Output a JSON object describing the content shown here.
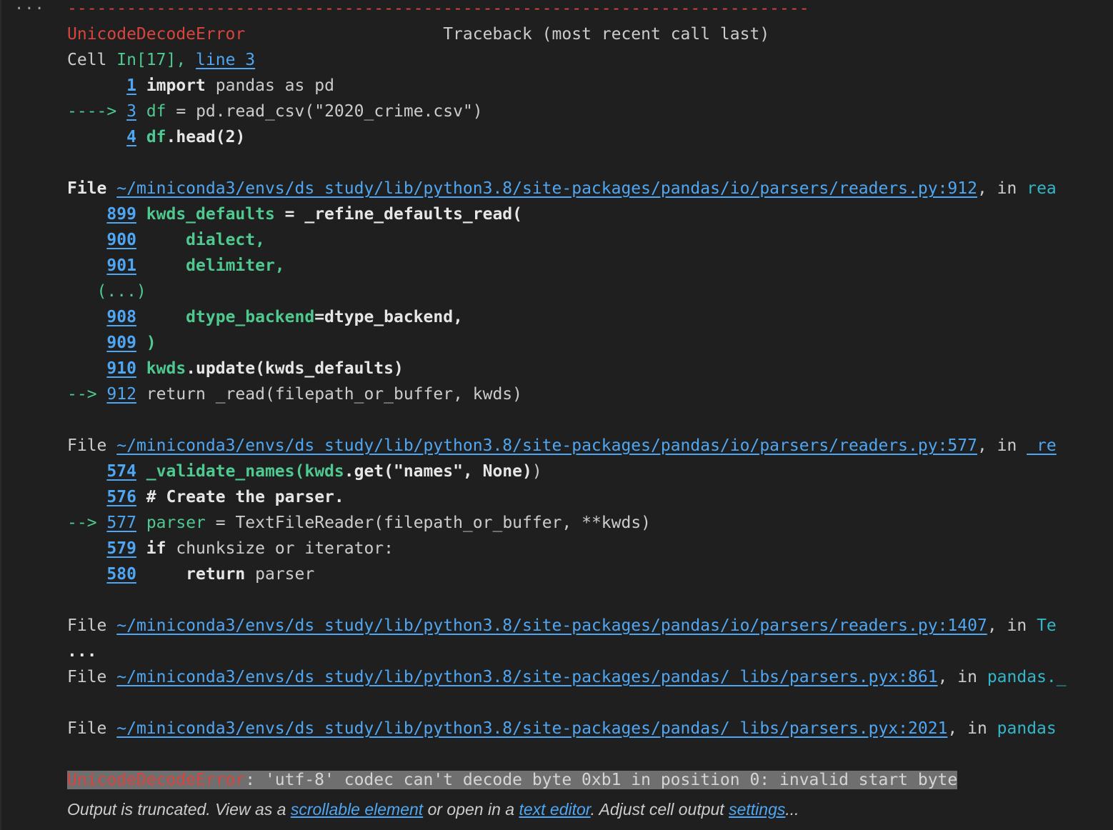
{
  "menu_glyph": "...",
  "error": {
    "dashes": "---------------------------------------------------------------------------",
    "name": "UnicodeDecodeError",
    "traceback_title": "Traceback (most recent call last)",
    "cell_prefix": "Cell ",
    "cell_in": "In[17]",
    "cell_comma": ", ",
    "cell_line": "line 3"
  },
  "cell_frame": {
    "l1_num": "1",
    "l1_kw": "import",
    "l1_rest": " pandas as pd",
    "l2_arrow": "---->",
    "l2_num": "3",
    "l2_var": "df",
    "l2_rest": " = pd.read_csv(\"2020_crime.csv\")",
    "l3_num": "4",
    "l3_var": "df",
    "l3_dot": ".",
    "l3_rest": "head(2)"
  },
  "frame1": {
    "file_label": "File",
    "path": "~/miniconda3/envs/ds_study/lib/python3.8/site-packages/pandas/io/parsers/readers.py:912",
    "in_text": ", in ",
    "func": "rea",
    "l899_num": "899",
    "l899_var": "kwds_defaults",
    "l899_eq": " = ",
    "l899_fn": "_refine_defaults_read(",
    "l900_num": "900",
    "l900_code": "    dialect,",
    "l901_num": "901",
    "l901_code": "    delimiter,",
    "ellipsis": "(...)",
    "l908_num": "908",
    "l908_arg": "    dtype_backend",
    "l908_rest": "=dtype_backend,",
    "l909_num": "909",
    "l909_code": ")",
    "l910_num": "910",
    "l910_var": "kwds",
    "l910_rest": ".update(kwds_defaults)",
    "l912_arrow": "-->",
    "l912_num": "912",
    "l912_code": " return _read(filepath_or_buffer, kwds)"
  },
  "frame2": {
    "file_label": "File",
    "path": "~/miniconda3/envs/ds_study/lib/python3.8/site-packages/pandas/io/parsers/readers.py:577",
    "in_text": ", in ",
    "func": "_re",
    "l574_num": "574",
    "l574_fn": "_validate_names(kwds",
    "l574_rest": ".get(\"names\", None)",
    "l574_close": ")",
    "l576_num": "576",
    "l576_code": "# Create the parser.",
    "l577_arrow": "-->",
    "l577_num": "577",
    "l577_var": "parser",
    "l577_rest": " = TextFileReader(filepath_or_buffer, **kwds)",
    "l579_num": "579",
    "l579_kw": "if",
    "l579_rest": " chunksize or iterator:",
    "l580_num": "580",
    "l580_kw": "    return",
    "l580_rest": " parser"
  },
  "frame3": {
    "file_label": "File",
    "path": "~/miniconda3/envs/ds_study/lib/python3.8/site-packages/pandas/io/parsers/readers.py:1407",
    "in_text": ", in ",
    "func": "Te",
    "ellipsis": "..."
  },
  "frame4": {
    "file_label": "File",
    "path": "~/miniconda3/envs/ds_study/lib/python3.8/site-packages/pandas/_libs/parsers.pyx:861",
    "in_text": ", in ",
    "func": "pandas._"
  },
  "frame5": {
    "file_label": "File",
    "path": "~/miniconda3/envs/ds_study/lib/python3.8/site-packages/pandas/_libs/parsers.pyx:2021",
    "in_text": ", in ",
    "func": "pandas"
  },
  "final_error": {
    "name": "UnicodeDecodeError",
    "message": ": 'utf-8' codec can't decode byte 0xb1 in position 0: invalid start byte"
  },
  "footer": {
    "t1": "Output is truncated. View as a ",
    "link1": "scrollable element",
    "t2": " or open in a ",
    "link2": "text editor",
    "t3": ". Adjust cell output ",
    "link3": "settings",
    "t4": "..."
  }
}
